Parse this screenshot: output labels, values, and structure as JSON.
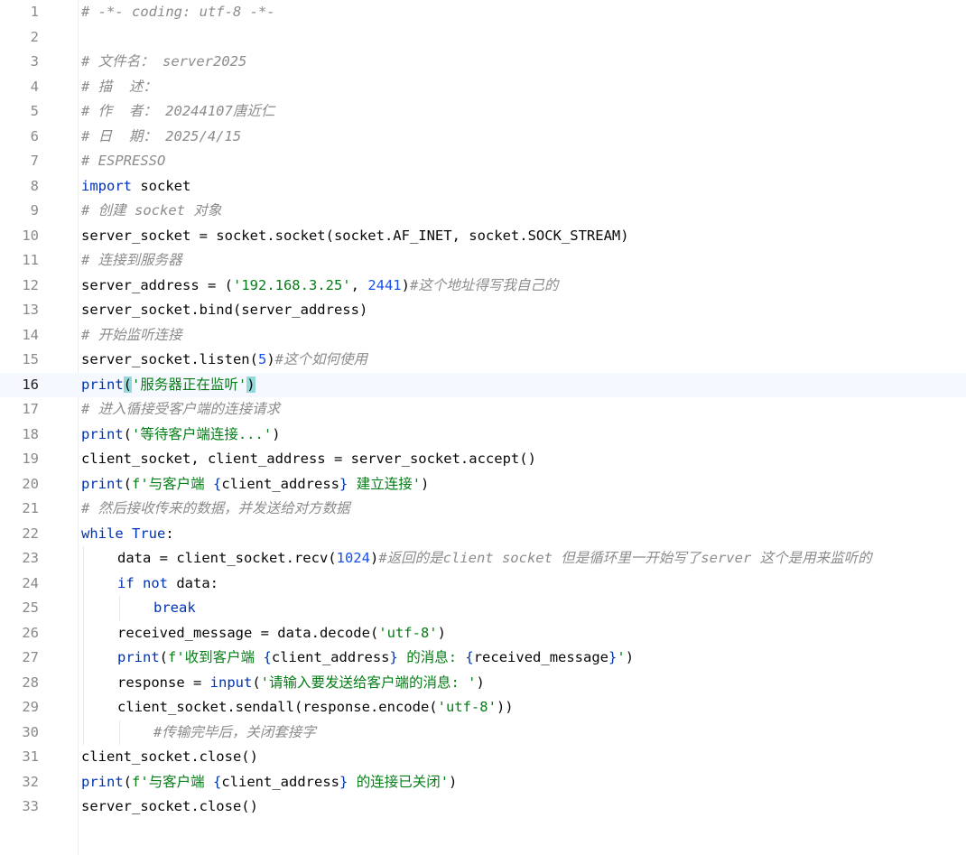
{
  "editor": {
    "current_line": 16,
    "lines": [
      {
        "n": "1",
        "indent": 0,
        "tokens": [
          {
            "t": "# -*- coding: utf-8 -*-",
            "c": "comment"
          }
        ]
      },
      {
        "n": "2",
        "indent": 0,
        "tokens": []
      },
      {
        "n": "3",
        "indent": 0,
        "tokens": [
          {
            "t": "# 文件名： server2025",
            "c": "comment"
          }
        ]
      },
      {
        "n": "4",
        "indent": 0,
        "tokens": [
          {
            "t": "# 描  述：",
            "c": "comment"
          }
        ]
      },
      {
        "n": "5",
        "indent": 0,
        "tokens": [
          {
            "t": "# 作  者： 20244107唐近仁",
            "c": "comment"
          }
        ]
      },
      {
        "n": "6",
        "indent": 0,
        "tokens": [
          {
            "t": "# 日  期： 2025/4/15",
            "c": "comment"
          }
        ]
      },
      {
        "n": "7",
        "indent": 0,
        "tokens": [
          {
            "t": "# ESPRESSO",
            "c": "comment"
          }
        ]
      },
      {
        "n": "8",
        "indent": 0,
        "tokens": [
          {
            "t": "import",
            "c": "kw"
          },
          {
            "t": " socket",
            "c": ""
          }
        ]
      },
      {
        "n": "9",
        "indent": 0,
        "tokens": [
          {
            "t": "# 创建 socket 对象",
            "c": "comment"
          }
        ]
      },
      {
        "n": "10",
        "indent": 0,
        "tokens": [
          {
            "t": "server_socket = socket.socket(socket.AF_INET, socket.SOCK_STREAM)",
            "c": ""
          }
        ]
      },
      {
        "n": "11",
        "indent": 0,
        "tokens": [
          {
            "t": "# 连接到服务器",
            "c": "comment"
          }
        ]
      },
      {
        "n": "12",
        "indent": 0,
        "tokens": [
          {
            "t": "server_address = (",
            "c": ""
          },
          {
            "t": "'192.168.3.25'",
            "c": "str"
          },
          {
            "t": ", ",
            "c": ""
          },
          {
            "t": "2441",
            "c": "num"
          },
          {
            "t": ")",
            "c": ""
          },
          {
            "t": "#这个地址得写我自己的",
            "c": "comment"
          }
        ]
      },
      {
        "n": "13",
        "indent": 0,
        "tokens": [
          {
            "t": "server_socket.bind(server_address)",
            "c": ""
          }
        ]
      },
      {
        "n": "14",
        "indent": 0,
        "tokens": [
          {
            "t": "# 开始监听连接",
            "c": "comment"
          }
        ]
      },
      {
        "n": "15",
        "indent": 0,
        "tokens": [
          {
            "t": "server_socket.listen(",
            "c": ""
          },
          {
            "t": "5",
            "c": "num"
          },
          {
            "t": ")",
            "c": ""
          },
          {
            "t": "#这个如何使用",
            "c": "comment"
          }
        ]
      },
      {
        "n": "16",
        "indent": 0,
        "tokens": [
          {
            "t": "print",
            "c": "kw"
          },
          {
            "t": "(",
            "c": "match"
          },
          {
            "t": "'服务器正在监听'",
            "c": "str"
          },
          {
            "t": ")",
            "c": "match"
          }
        ]
      },
      {
        "n": "17",
        "indent": 0,
        "tokens": [
          {
            "t": "# 进入循接受客户端的连接请求",
            "c": "comment"
          }
        ]
      },
      {
        "n": "18",
        "indent": 0,
        "tokens": [
          {
            "t": "print",
            "c": "kw"
          },
          {
            "t": "(",
            "c": ""
          },
          {
            "t": "'等待客户端连接...'",
            "c": "str"
          },
          {
            "t": ")",
            "c": ""
          }
        ]
      },
      {
        "n": "19",
        "indent": 0,
        "tokens": [
          {
            "t": "client_socket, client_address = server_socket.accept()",
            "c": ""
          }
        ]
      },
      {
        "n": "20",
        "indent": 0,
        "tokens": [
          {
            "t": "print",
            "c": "kw"
          },
          {
            "t": "(",
            "c": ""
          },
          {
            "t": "f'与客户端 ",
            "c": "str"
          },
          {
            "t": "{",
            "c": "brace"
          },
          {
            "t": "client_address",
            "c": ""
          },
          {
            "t": "}",
            "c": "brace"
          },
          {
            "t": " 建立连接'",
            "c": "str"
          },
          {
            "t": ")",
            "c": ""
          }
        ]
      },
      {
        "n": "21",
        "indent": 0,
        "tokens": [
          {
            "t": "# 然后接收传来的数据，并发送给对方数据",
            "c": "comment"
          }
        ]
      },
      {
        "n": "22",
        "indent": 0,
        "tokens": [
          {
            "t": "while",
            "c": "kw"
          },
          {
            "t": " ",
            "c": ""
          },
          {
            "t": "True",
            "c": "kw"
          },
          {
            "t": ":",
            "c": ""
          }
        ]
      },
      {
        "n": "23",
        "indent": 1,
        "tokens": [
          {
            "t": "data = client_socket.recv(",
            "c": ""
          },
          {
            "t": "1024",
            "c": "num"
          },
          {
            "t": ")",
            "c": ""
          },
          {
            "t": "#返回的是client socket 但是循环里一开始写了server 这个是用来监听的",
            "c": "comment"
          }
        ]
      },
      {
        "n": "24",
        "indent": 1,
        "tokens": [
          {
            "t": "if",
            "c": "kw"
          },
          {
            "t": " ",
            "c": ""
          },
          {
            "t": "not",
            "c": "kw"
          },
          {
            "t": " data:",
            "c": ""
          }
        ]
      },
      {
        "n": "25",
        "indent": 2,
        "tokens": [
          {
            "t": "break",
            "c": "kw"
          }
        ]
      },
      {
        "n": "26",
        "indent": 1,
        "tokens": [
          {
            "t": "received_message = data.decode(",
            "c": ""
          },
          {
            "t": "'utf-8'",
            "c": "str"
          },
          {
            "t": ")",
            "c": ""
          }
        ]
      },
      {
        "n": "27",
        "indent": 1,
        "tokens": [
          {
            "t": "print",
            "c": "kw"
          },
          {
            "t": "(",
            "c": ""
          },
          {
            "t": "f'收到客户端 ",
            "c": "str"
          },
          {
            "t": "{",
            "c": "brace"
          },
          {
            "t": "client_address",
            "c": ""
          },
          {
            "t": "}",
            "c": "brace"
          },
          {
            "t": " 的消息: ",
            "c": "str"
          },
          {
            "t": "{",
            "c": "brace"
          },
          {
            "t": "received_message",
            "c": ""
          },
          {
            "t": "}",
            "c": "brace"
          },
          {
            "t": "'",
            "c": "str"
          },
          {
            "t": ")",
            "c": ""
          }
        ]
      },
      {
        "n": "28",
        "indent": 1,
        "tokens": [
          {
            "t": "response = ",
            "c": ""
          },
          {
            "t": "input",
            "c": "kw"
          },
          {
            "t": "(",
            "c": ""
          },
          {
            "t": "'请输入要发送给客户端的消息: '",
            "c": "str"
          },
          {
            "t": ")",
            "c": ""
          }
        ]
      },
      {
        "n": "29",
        "indent": 1,
        "tokens": [
          {
            "t": "client_socket.sendall(response.encode(",
            "c": ""
          },
          {
            "t": "'utf-8'",
            "c": "str"
          },
          {
            "t": "))",
            "c": ""
          }
        ]
      },
      {
        "n": "30",
        "indent": 2,
        "tokens": [
          {
            "t": "#传输完毕后，关闭套接字",
            "c": "comment"
          }
        ]
      },
      {
        "n": "31",
        "indent": 0,
        "tokens": [
          {
            "t": "client_socket.close()",
            "c": ""
          }
        ]
      },
      {
        "n": "32",
        "indent": 0,
        "tokens": [
          {
            "t": "print",
            "c": "kw"
          },
          {
            "t": "(",
            "c": ""
          },
          {
            "t": "f'与客户端 ",
            "c": "str"
          },
          {
            "t": "{",
            "c": "brace"
          },
          {
            "t": "client_address",
            "c": ""
          },
          {
            "t": "}",
            "c": "brace"
          },
          {
            "t": " 的连接已关闭'",
            "c": "str"
          },
          {
            "t": ")",
            "c": ""
          }
        ]
      },
      {
        "n": "33",
        "indent": 0,
        "tokens": [
          {
            "t": "server_socket.close()",
            "c": ""
          }
        ]
      }
    ]
  }
}
